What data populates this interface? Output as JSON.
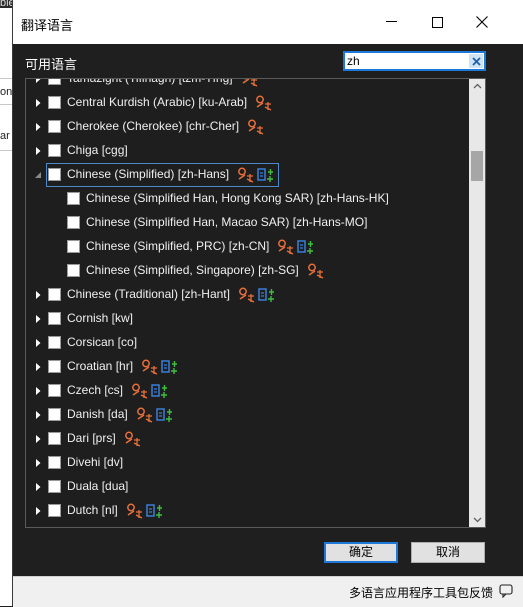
{
  "background": {
    "fragments": [
      "ble",
      "on",
      "ar"
    ]
  },
  "window": {
    "title": "翻译语言"
  },
  "header": {
    "available_label": "可用语言"
  },
  "search": {
    "value": "zh"
  },
  "languages": [
    {
      "label": "Tamazight (Tifinagh) [tzm-Tfng]",
      "expanded": false,
      "level": 0,
      "icons": [
        "machine-translate-icon"
      ]
    },
    {
      "label": "Central Kurdish (Arabic) [ku-Arab]",
      "expanded": false,
      "level": 0,
      "icons": [
        "machine-translate-icon"
      ]
    },
    {
      "label": "Cherokee (Cherokee) [chr-Cher]",
      "expanded": false,
      "level": 0,
      "icons": [
        "machine-translate-icon"
      ]
    },
    {
      "label": "Chiga [cgg]",
      "expanded": false,
      "level": 0,
      "icons": []
    },
    {
      "label": "Chinese (Simplified) [zh-Hans]",
      "expanded": true,
      "level": 0,
      "selected": true,
      "icons": [
        "machine-translate-icon",
        "language-pack-icon"
      ]
    },
    {
      "label": "Chinese (Simplified Han, Hong Kong SAR) [zh-Hans-HK]",
      "level": 1,
      "icons": []
    },
    {
      "label": "Chinese (Simplified Han, Macao SAR) [zh-Hans-MO]",
      "level": 1,
      "icons": []
    },
    {
      "label": "Chinese (Simplified, PRC) [zh-CN]",
      "level": 1,
      "icons": [
        "machine-translate-icon",
        "language-pack-icon"
      ]
    },
    {
      "label": "Chinese (Simplified, Singapore) [zh-SG]",
      "level": 1,
      "icons": [
        "machine-translate-icon"
      ]
    },
    {
      "label": "Chinese (Traditional) [zh-Hant]",
      "expanded": false,
      "level": 0,
      "icons": [
        "machine-translate-icon",
        "language-pack-icon"
      ]
    },
    {
      "label": "Cornish [kw]",
      "expanded": false,
      "level": 0,
      "icons": []
    },
    {
      "label": "Corsican [co]",
      "expanded": false,
      "level": 0,
      "icons": []
    },
    {
      "label": "Croatian [hr]",
      "expanded": false,
      "level": 0,
      "icons": [
        "machine-translate-icon",
        "language-pack-icon"
      ]
    },
    {
      "label": "Czech [cs]",
      "expanded": false,
      "level": 0,
      "icons": [
        "machine-translate-icon",
        "language-pack-icon"
      ]
    },
    {
      "label": "Danish [da]",
      "expanded": false,
      "level": 0,
      "icons": [
        "machine-translate-icon",
        "language-pack-icon"
      ]
    },
    {
      "label": "Dari [prs]",
      "expanded": false,
      "level": 0,
      "icons": [
        "machine-translate-icon"
      ]
    },
    {
      "label": "Divehi [dv]",
      "expanded": false,
      "level": 0,
      "icons": []
    },
    {
      "label": "Duala [dua]",
      "expanded": false,
      "level": 0,
      "icons": []
    },
    {
      "label": "Dutch [nl]",
      "expanded": false,
      "level": 0,
      "icons": [
        "machine-translate-icon",
        "language-pack-icon"
      ]
    }
  ],
  "buttons": {
    "ok": "确定",
    "cancel": "取消"
  },
  "footer": {
    "feedback": "多语言应用程序工具包反馈"
  },
  "colors": {
    "accent": "#1e78d7",
    "machine_translate": "#e8703a",
    "language_pack_blue": "#3a7fd6",
    "language_pack_green": "#3fbf3f",
    "selection_border": "#4d88c9"
  }
}
